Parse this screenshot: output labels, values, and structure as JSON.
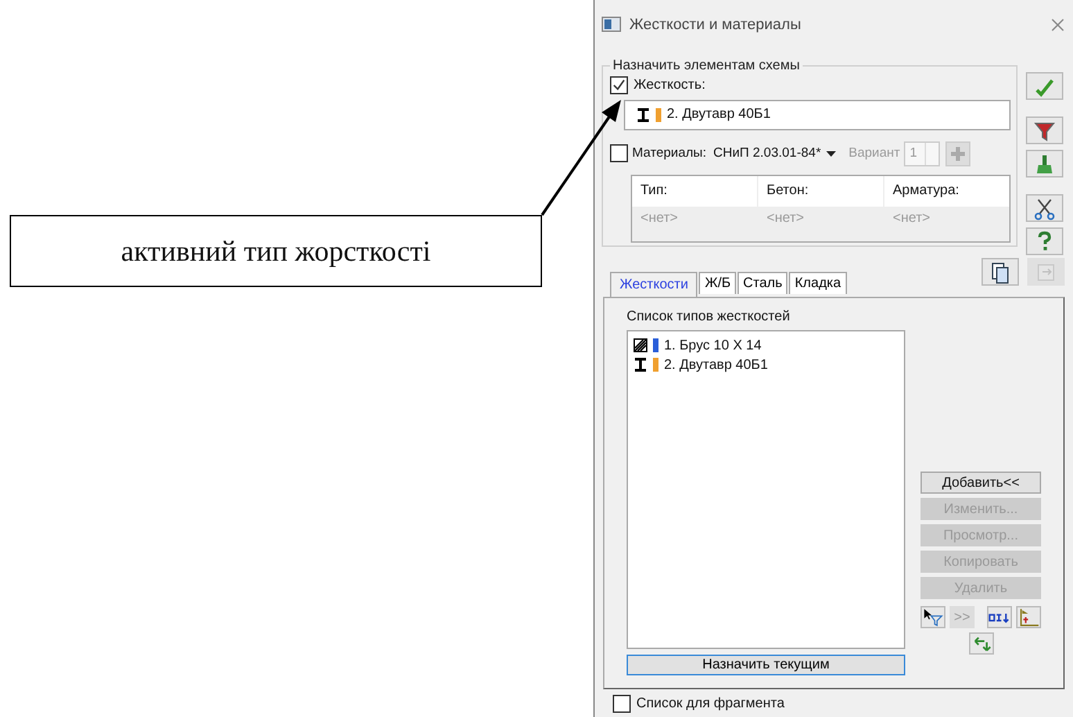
{
  "callout": {
    "text": "активний тип жорсткості"
  },
  "window": {
    "title": "Жесткости и материалы"
  },
  "assign_group": {
    "title": "Назначить элементам схемы",
    "stiffness": {
      "label": "Жесткость:",
      "checked": true
    },
    "active_stiffness": {
      "kind": "ibeam",
      "color": "#f0a030",
      "text": "2. Двутавр 40Б1"
    },
    "materials": {
      "label": "Материалы:",
      "checked": false,
      "norm": "СНиП 2.03.01-84*",
      "variant_label": "Вариант",
      "variant_value": "1"
    },
    "materials_table": {
      "columns": [
        "Тип:",
        "Бетон:",
        "Арматура:"
      ],
      "rows": [
        [
          "<нет>",
          "<нет>",
          "<нет>"
        ]
      ]
    }
  },
  "side_buttons": [
    {
      "kind": "check"
    },
    {
      "kind": "filter"
    },
    {
      "kind": "brush"
    },
    {
      "kind": "scissors"
    },
    {
      "kind": "help"
    }
  ],
  "top_tools": [
    {
      "kind": "copy",
      "disabled": false
    },
    {
      "kind": "paste",
      "disabled": true
    }
  ],
  "tabs": [
    {
      "label": "Жесткости",
      "selected": true
    },
    {
      "label": "Ж/Б",
      "selected": false
    },
    {
      "label": "Сталь",
      "selected": false
    },
    {
      "label": "Кладка",
      "selected": false
    }
  ],
  "stiffness_list": {
    "label": "Список типов жесткостей",
    "items": [
      {
        "kind": "timber",
        "color": "#2b5fd9",
        "text": "1. Брус 10 X 14"
      },
      {
        "kind": "ibeam",
        "color": "#f0a030",
        "text": "2. Двутавр 40Б1"
      }
    ]
  },
  "action_buttons": [
    {
      "label": "Добавить<<",
      "disabled": false
    },
    {
      "label": "Изменить...",
      "disabled": true
    },
    {
      "label": "Просмотр...",
      "disabled": true
    },
    {
      "label": "Копировать",
      "disabled": true
    },
    {
      "label": "Удалить",
      "disabled": true
    }
  ],
  "tool_buttons": [
    {
      "kind": "select-filter",
      "disabled": false
    },
    {
      "kind": "text",
      "label": ">>",
      "disabled": true
    },
    {
      "kind": "section",
      "disabled": false
    },
    {
      "kind": "chart",
      "disabled": false
    }
  ],
  "swap_button": {
    "kind": "swap"
  },
  "assign_button": {
    "label": "Назначить текущим",
    "focused": true
  },
  "fragment_list": {
    "label": "Список для фрагмента",
    "checked": false
  }
}
